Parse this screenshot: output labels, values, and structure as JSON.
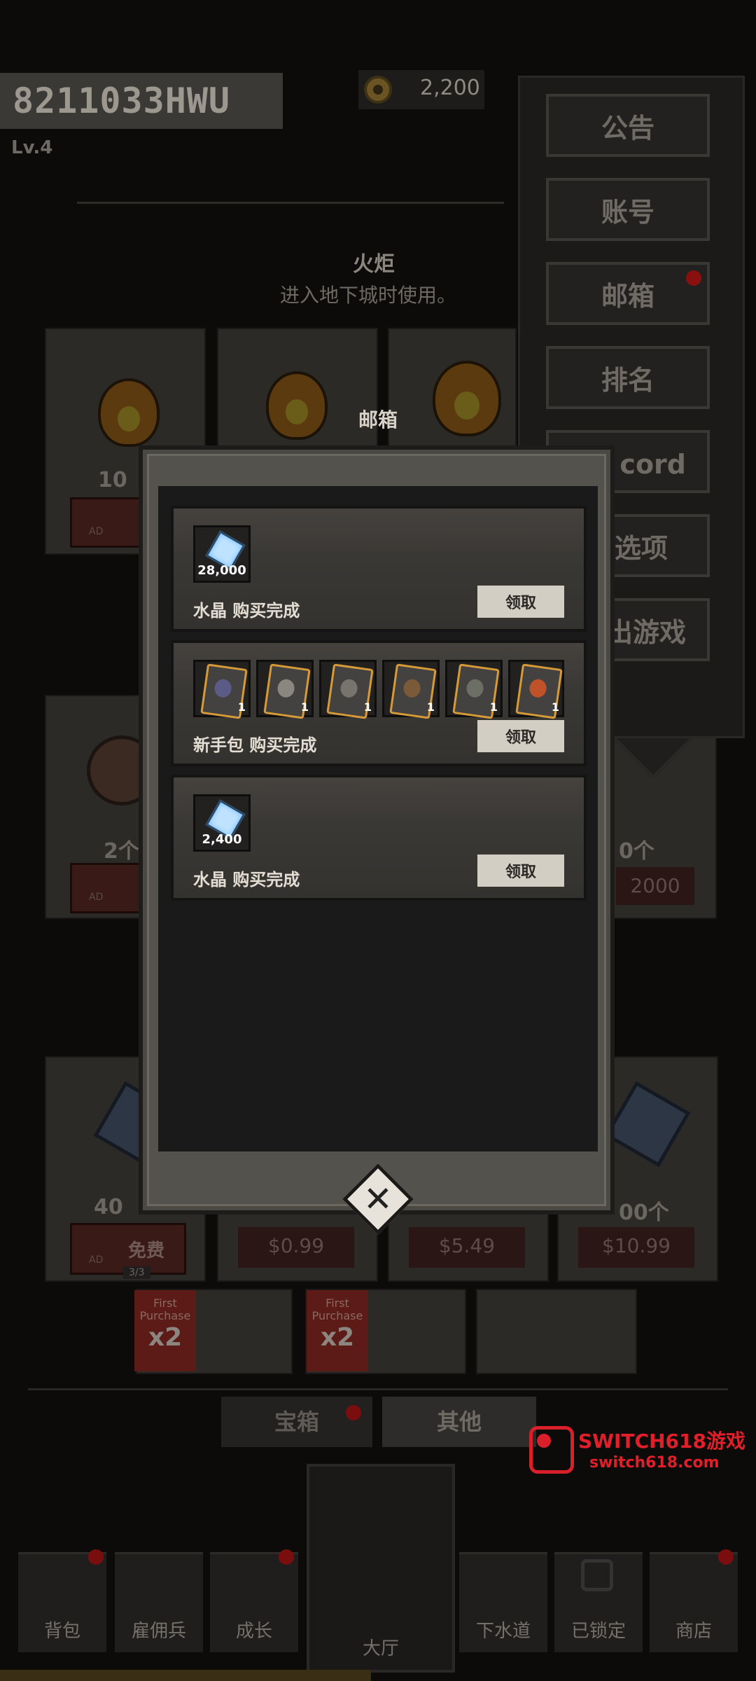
{
  "player": {
    "id": "8211033HWU",
    "level": "Lv.4"
  },
  "currency": {
    "coins": "2,200"
  },
  "side_menu": {
    "items": [
      "公告",
      "账号",
      "邮箱",
      "排名",
      "Discord",
      "选项",
      "退出游戏"
    ],
    "visible": [
      "公告",
      "账号",
      "邮箱",
      "排名",
      "cord",
      "选项",
      "出游戏"
    ]
  },
  "shop": {
    "torch_title": "火炬",
    "torch_desc": "进入地下城时使用。",
    "row1_amount_left": "10",
    "row2_amount_left": "2个",
    "row2_amount_right": "0个",
    "row2_price_right": "2000",
    "row3_amount_left": "40",
    "row3_amount_right": "00个",
    "row3_free": "免费",
    "row3_counter": "3/3",
    "prices": [
      "$0.99",
      "$5.49",
      "$10.99"
    ],
    "first_purchase": "First Purchase",
    "multiplier": "x2",
    "ad_label": "AD"
  },
  "shop_tabs": [
    "宝箱",
    "其他"
  ],
  "bottom_nav": [
    "背包",
    "雇佣兵",
    "成长",
    "大厅",
    "下水道",
    "已锁定",
    "商店"
  ],
  "mailbox": {
    "title": "邮箱",
    "claim_label": "领取",
    "mails": [
      {
        "text": "水晶 购买完成",
        "items": [
          {
            "icon": "crystal-icon",
            "qty": "28,000"
          }
        ]
      },
      {
        "text": "新手包 购买完成",
        "items": [
          {
            "icon": "mercenary-card-icon",
            "qty": "1"
          },
          {
            "icon": "mercenary-card-icon",
            "qty": "1"
          },
          {
            "icon": "mercenary-card-icon",
            "qty": "1"
          },
          {
            "icon": "mercenary-card-icon",
            "qty": "1"
          },
          {
            "icon": "mercenary-card-icon",
            "qty": "1"
          },
          {
            "icon": "mercenary-card-icon",
            "qty": "1"
          }
        ]
      },
      {
        "text": "水晶 购买完成",
        "items": [
          {
            "icon": "crystal-icon",
            "qty": "2,400"
          }
        ]
      }
    ]
  },
  "watermark": {
    "brand": "SWITCH618游戏",
    "url": "switch618.com"
  },
  "colors": {
    "claim_button": "#d3cec4",
    "modal_frame": "#4b4944",
    "card_border": "#d69a38",
    "watermark": "#e01f2a"
  }
}
